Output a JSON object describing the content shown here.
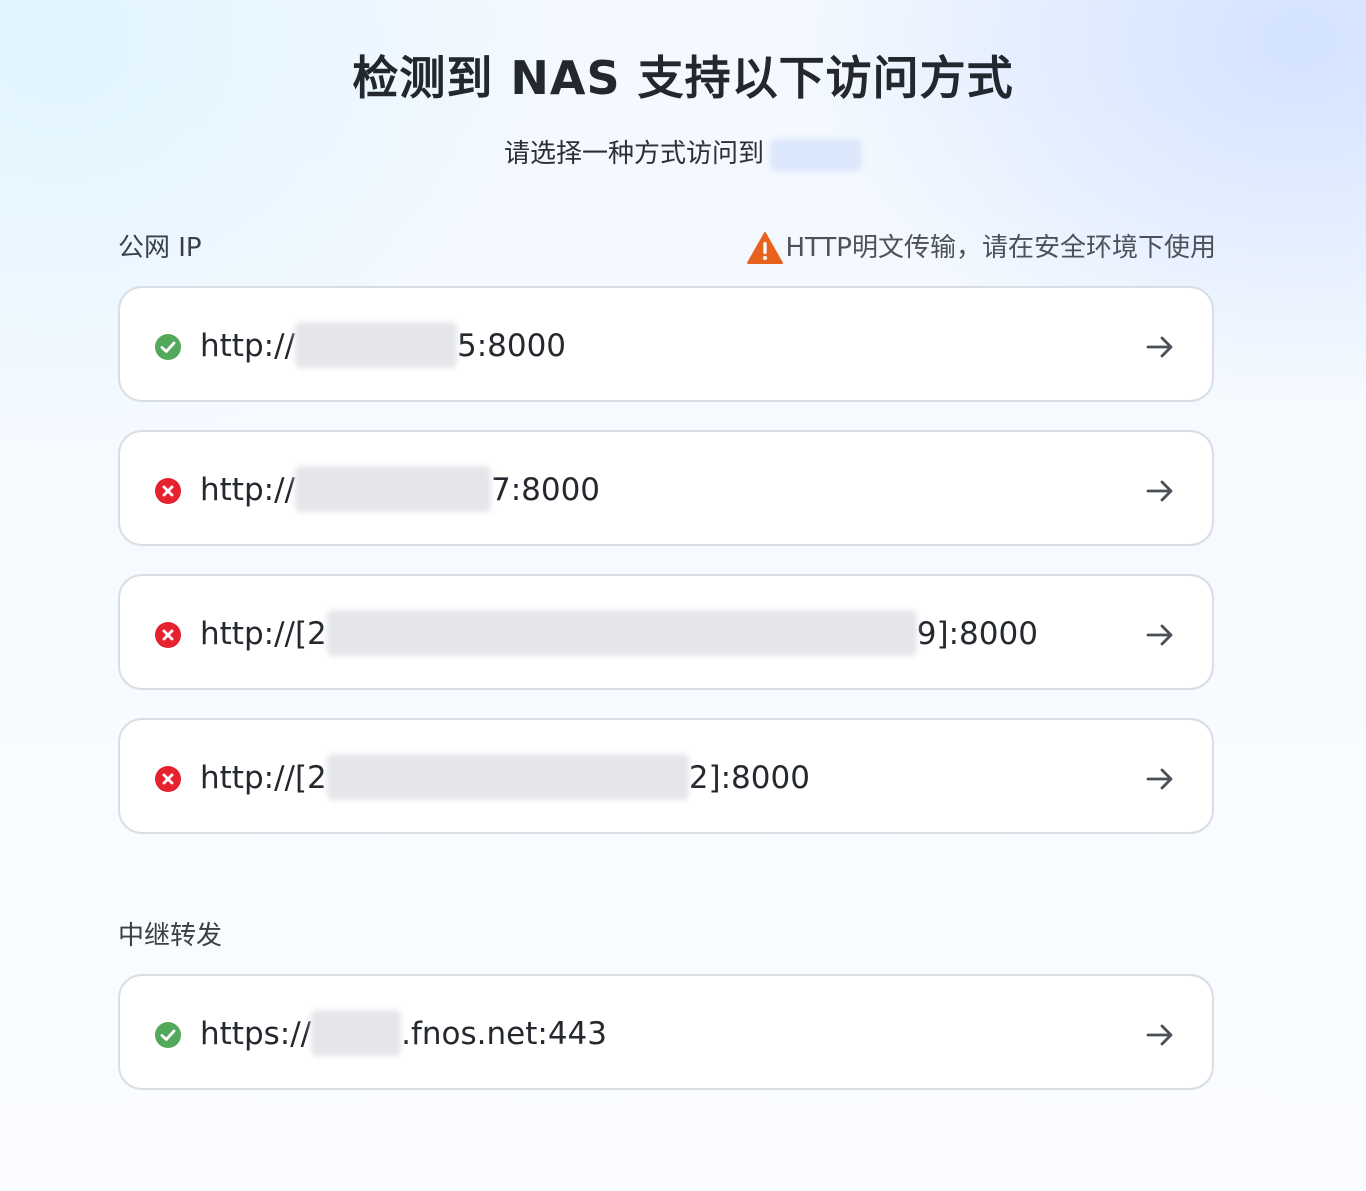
{
  "header": {
    "title": "检测到 NAS 支持以下访问方式",
    "subtitle": "请选择一种方式访问到"
  },
  "public_ip": {
    "label": "公网 IP",
    "warning": "HTTP明文传输，请在安全环境下使用",
    "entries": [
      {
        "status": "success",
        "prefix": "http://",
        "suffix": "5:8000"
      },
      {
        "status": "error",
        "prefix": "http://",
        "suffix": "7:8000"
      },
      {
        "status": "error",
        "prefix": "http://[2",
        "suffix": "9]:8000"
      },
      {
        "status": "error",
        "prefix": "http://[2",
        "suffix": "2]:8000"
      }
    ]
  },
  "relay": {
    "label": "中继转发",
    "entries": [
      {
        "status": "success",
        "prefix": "https://",
        "suffix": ".fnos.net:443"
      }
    ]
  },
  "colors": {
    "success": "#52a95c",
    "error": "#e5222e",
    "warning": "#e8621f",
    "arrow": "#4a4f58"
  }
}
